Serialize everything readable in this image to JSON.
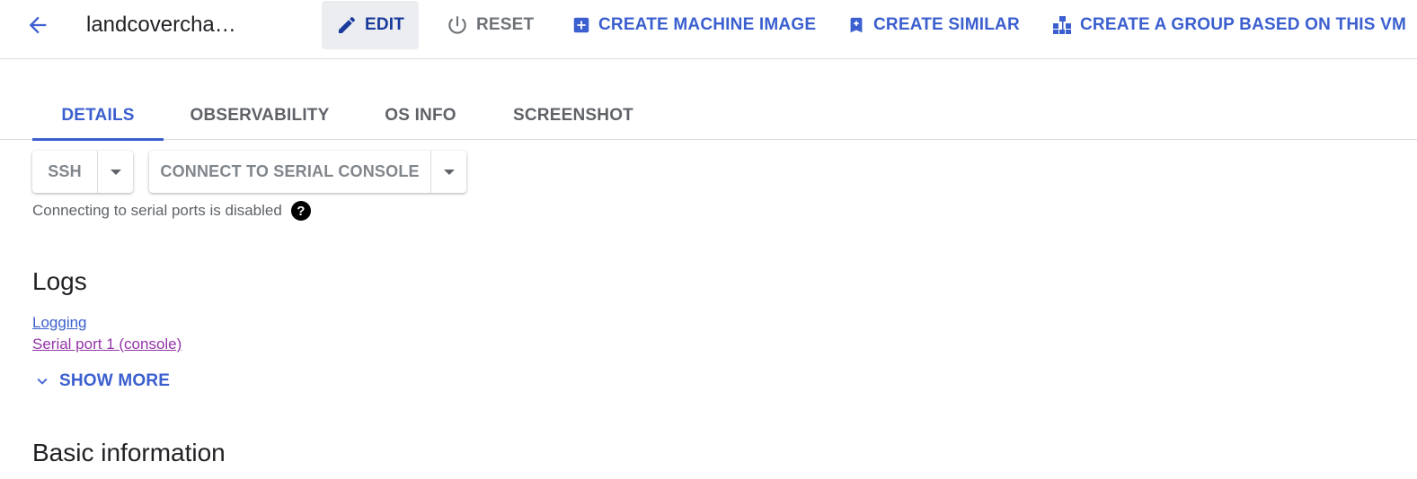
{
  "header": {
    "title": "landcovercha…",
    "actions": {
      "edit": "EDIT",
      "reset": "RESET",
      "create_machine_image": "CREATE MACHINE IMAGE",
      "create_similar": "CREATE SIMILAR",
      "create_group": "CREATE A GROUP BASED ON THIS VM"
    }
  },
  "tabs": [
    {
      "label": "DETAILS",
      "active": true
    },
    {
      "label": "OBSERVABILITY",
      "active": false
    },
    {
      "label": "OS INFO",
      "active": false
    },
    {
      "label": "SCREENSHOT",
      "active": false
    }
  ],
  "connect": {
    "ssh_label": "SSH",
    "serial_label": "CONNECT TO SERIAL CONSOLE",
    "serial_note": "Connecting to serial ports is disabled",
    "help_glyph": "?"
  },
  "logs": {
    "title": "Logs",
    "links": [
      "Logging",
      "Serial port 1 (console)"
    ],
    "show_more": "SHOW MORE"
  },
  "basic_info": {
    "title": "Basic information"
  },
  "icons": {
    "back": "arrow-back-icon",
    "edit": "pencil-icon",
    "reset": "power-icon",
    "machine_image": "add-box-icon",
    "similar": "add-bookmark-icon",
    "group": "group-nodes-icon",
    "dropdown": "caret-down-icon",
    "help": "help-circle-icon",
    "expand": "chevron-down-icon"
  },
  "colors": {
    "accent": "#3b5fcf",
    "edit_text": "#1a3a9c",
    "visited_link": "#9334a8",
    "muted": "#5f6368"
  }
}
